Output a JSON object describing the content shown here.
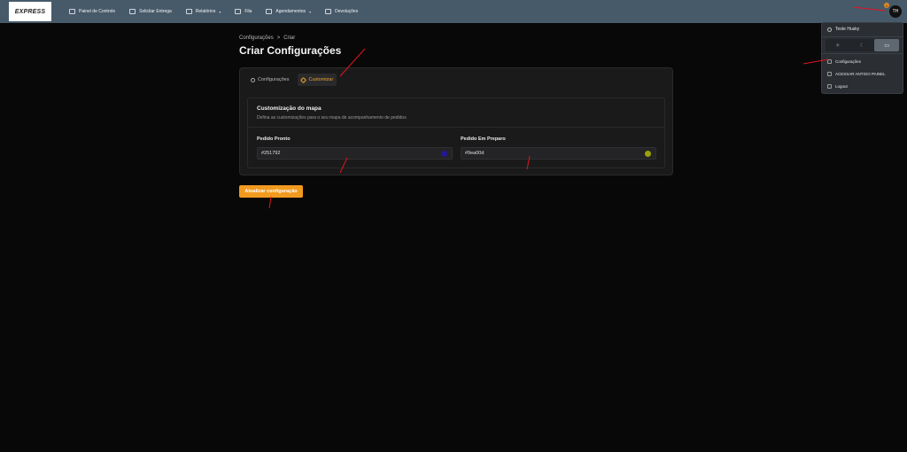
{
  "header": {
    "logo_text": "EXPRESS",
    "nav": [
      {
        "label": "Painel de Controle",
        "icon": "dashboard-icon"
      },
      {
        "label": "Solicitar Entrega",
        "icon": "send-icon"
      },
      {
        "label": "Relatórios",
        "icon": "report-icon"
      },
      {
        "label": "Fila",
        "icon": "queue-icon"
      },
      {
        "label": "Agendamentos",
        "icon": "calendar-icon"
      },
      {
        "label": "Devoluções",
        "icon": "return-icon"
      }
    ],
    "avatar_initials": "TH",
    "notification_count": "1"
  },
  "user_menu": {
    "user_name": "Teste Husky",
    "themes": [
      "light-icon",
      "dark-icon",
      "system-icon"
    ],
    "items": [
      "Configurações",
      "ACESSAR ANTIGO PAINEL",
      "Logout"
    ]
  },
  "breadcrumb": {
    "parent": "Configurações",
    "separator": ">",
    "current": "Criar"
  },
  "page_title": "Criar Configurações",
  "tabs": [
    "Configurações",
    "Customizar"
  ],
  "section": {
    "title": "Customização do mapa",
    "description": "Defina as customizações para o seu mapa de acompanhamento de pedidos"
  },
  "fields": {
    "pronto": {
      "label": "Pedido Pronto",
      "value": "#251792",
      "color": "#251792"
    },
    "preparo": {
      "label": "Pedido Em Preparo",
      "value": "#9ea00d",
      "color": "#9ea00d"
    }
  },
  "update_button": "Atualizar configuração",
  "colors": {
    "accent": "#f29a1f",
    "topbar": "#475a6a",
    "annotation": "#e0141e"
  }
}
